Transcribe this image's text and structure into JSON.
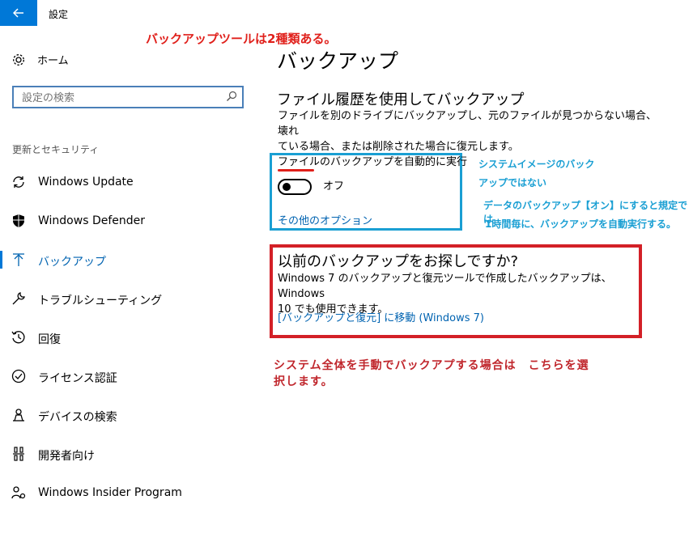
{
  "window": {
    "title": "設定"
  },
  "sidebar": {
    "home_label": "ホーム",
    "search_placeholder": "設定の検索",
    "section_label": "更新とセキュリティ",
    "items": [
      {
        "label": "Windows Update",
        "icon": "sync-icon"
      },
      {
        "label": "Windows Defender",
        "icon": "shield-icon"
      },
      {
        "label": "バックアップ",
        "icon": "arrow-up-icon",
        "active": true
      },
      {
        "label": "トラブルシューティング",
        "icon": "wrench-icon"
      },
      {
        "label": "回復",
        "icon": "history-icon"
      },
      {
        "label": "ライセンス認証",
        "icon": "check-circle-icon"
      },
      {
        "label": "デバイスの検索",
        "icon": "person-pin-icon"
      },
      {
        "label": "開発者向け",
        "icon": "developer-icon"
      },
      {
        "label": "Windows Insider Program",
        "icon": "insider-icon"
      }
    ]
  },
  "main": {
    "page_title": "バックアップ",
    "file_history": {
      "heading": "ファイル履歴を使用してバックアップ",
      "description_line1": "ファイルを別のドライブにバックアップし、元のファイルが見つからない場合、壊れ",
      "description_line2": "ている場合、または削除された場合に復元します。",
      "auto_backup_label": "ファイルのバックアップを自動的に実行",
      "toggle_state": "オフ",
      "more_options_link": "その他のオプション"
    },
    "older_backup": {
      "heading": "以前のバックアップをお探しですか?",
      "description_line1": "Windows 7 のバックアップと復元ツールで作成したバックアップは、Windows",
      "description_line2": "10 でも使用できます。",
      "link": "[バックアップと復元] に移動 (Windows 7)"
    }
  },
  "annotations": {
    "top_red": "バックアップツールは2種類ある。",
    "blue_line1": "システムイメージのバック",
    "blue_line2": "アップではない",
    "blue_line3": "データのバックアップ【オン】にすると規定では",
    "blue_line4": "1時間毎に、バックアップを自動実行する。",
    "red_note_line1": "システム全体を手動でバックアプする場合は　こちらを選",
    "red_note_line2": "択します。"
  },
  "colors": {
    "accent": "#0078d7",
    "link": "#0063b1",
    "annotation_red": "#e0201b",
    "annotation_blue": "#1a9fd3",
    "box_red": "#d32027",
    "box_blue": "#1a9fd3"
  }
}
